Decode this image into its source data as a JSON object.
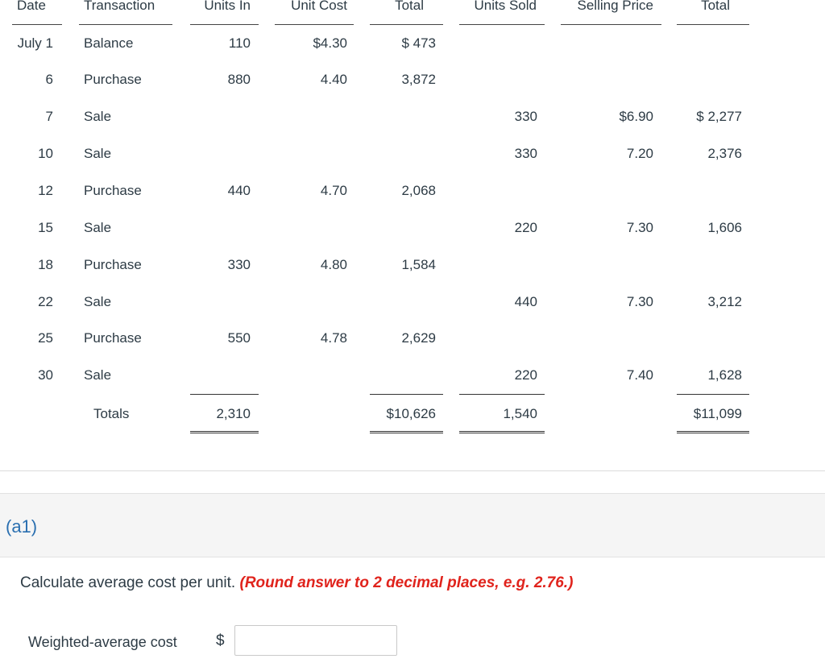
{
  "headers": {
    "date": "Date",
    "transaction": "Transaction",
    "units_in": "Units In",
    "unit_cost": "Unit Cost",
    "total_cost": "Total",
    "units_sold": "Units Sold",
    "selling_price": "Selling Price",
    "total_sales": "Total"
  },
  "rows": [
    {
      "date": "July 1",
      "transaction": "Balance",
      "units_in": "110",
      "unit_cost": "$4.30",
      "total": "$ 473",
      "units_sold": "",
      "selling_price": "",
      "sales_total": ""
    },
    {
      "date": "6",
      "transaction": "Purchase",
      "units_in": "880",
      "unit_cost": "4.40",
      "total": "3,872",
      "units_sold": "",
      "selling_price": "",
      "sales_total": ""
    },
    {
      "date": "7",
      "transaction": "Sale",
      "units_in": "",
      "unit_cost": "",
      "total": "",
      "units_sold": "330",
      "selling_price": "$6.90",
      "sales_total": "$ 2,277"
    },
    {
      "date": "10",
      "transaction": "Sale",
      "units_in": "",
      "unit_cost": "",
      "total": "",
      "units_sold": "330",
      "selling_price": "7.20",
      "sales_total": "2,376"
    },
    {
      "date": "12",
      "transaction": "Purchase",
      "units_in": "440",
      "unit_cost": "4.70",
      "total": "2,068",
      "units_sold": "",
      "selling_price": "",
      "sales_total": ""
    },
    {
      "date": "15",
      "transaction": "Sale",
      "units_in": "",
      "unit_cost": "",
      "total": "",
      "units_sold": "220",
      "selling_price": "7.30",
      "sales_total": "1,606"
    },
    {
      "date": "18",
      "transaction": "Purchase",
      "units_in": "330",
      "unit_cost": "4.80",
      "total": "1,584",
      "units_sold": "",
      "selling_price": "",
      "sales_total": ""
    },
    {
      "date": "22",
      "transaction": "Sale",
      "units_in": "",
      "unit_cost": "",
      "total": "",
      "units_sold": "440",
      "selling_price": "7.30",
      "sales_total": "3,212"
    },
    {
      "date": "25",
      "transaction": "Purchase",
      "units_in": "550",
      "unit_cost": "4.78",
      "total": "2,629",
      "units_sold": "",
      "selling_price": "",
      "sales_total": ""
    },
    {
      "date": "30",
      "transaction": "Sale",
      "units_in": "",
      "unit_cost": "",
      "total": "",
      "units_sold": "220",
      "selling_price": "7.40",
      "sales_total": "1,628"
    }
  ],
  "totals": {
    "label": "Totals",
    "units_in": "2,310",
    "total_cost": "$10,626",
    "units_sold": "1,540",
    "sales_total": "$11,099"
  },
  "part_label": "(a1)",
  "instruction": {
    "text": "Calculate average cost per unit.",
    "hint": "(Round answer to 2 decimal places, e.g. 2.76.)"
  },
  "answer": {
    "label": "Weighted-average cost",
    "currency": "$",
    "value": "",
    "placeholder": ""
  }
}
